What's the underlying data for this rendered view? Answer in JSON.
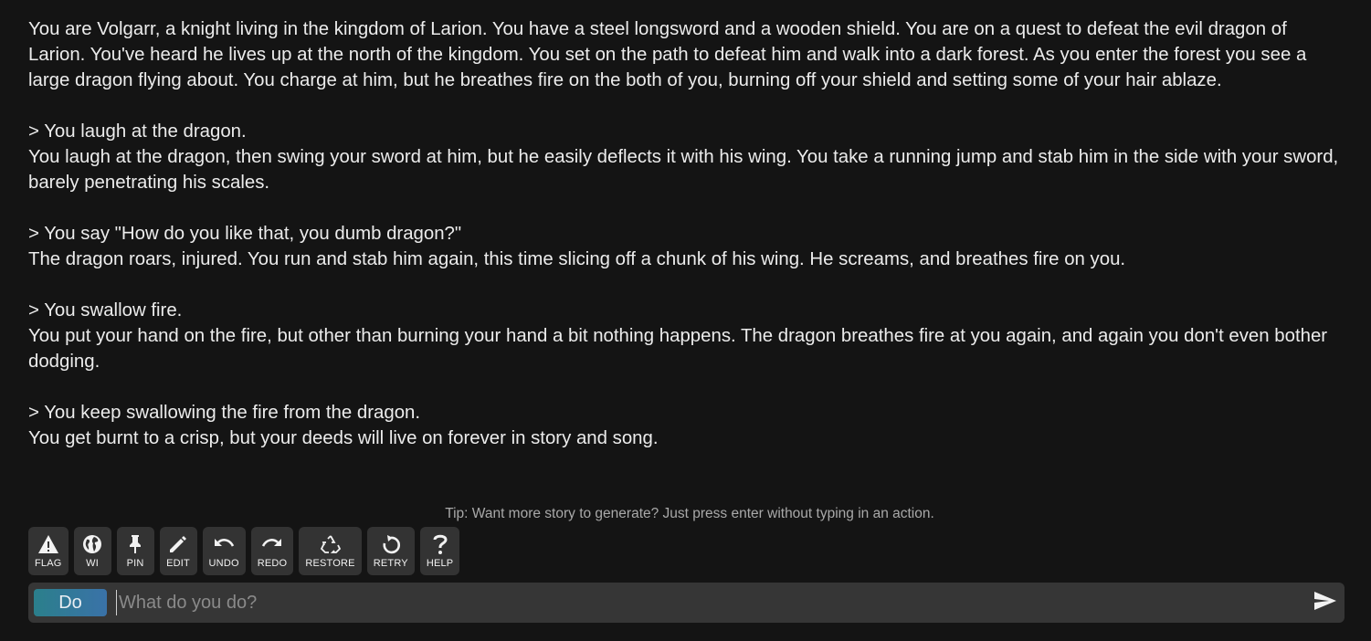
{
  "story": {
    "intro": "You are Volgarr, a knight living in the kingdom of Larion. You have a steel longsword and a wooden shield. You are on a quest to defeat the evil dragon of Larion. You've heard he lives up at the north of the kingdom. You set on the path to defeat him and walk into a dark forest. As you enter the forest you see a large dragon flying about. You charge at him, but he breathes fire on the both of you, burning off your shield and setting some of your hair ablaze.",
    "turns": [
      {
        "action": "> You laugh at the dragon.",
        "result": "You laugh at the dragon, then swing your sword at him, but he easily deflects it with his wing. You take a running jump and stab him in the side with your sword, barely penetrating his scales."
      },
      {
        "action": "> You say \"How do you like that, you dumb dragon?\"",
        "result": "The dragon roars, injured. You run and stab him again, this time slicing off a chunk of his wing. He screams, and breathes fire on you."
      },
      {
        "action": "> You swallow fire.",
        "result": "You put your hand on the fire, but other than burning your hand a bit nothing happens. The dragon breathes fire at you again, and again you don't even bother dodging."
      },
      {
        "action": "> You keep swallowing the fire from the dragon.",
        "result": "You get burnt to a crisp, but your deeds will live on forever in story and song."
      }
    ]
  },
  "tip": "Tip: Want more story to generate? Just press enter without typing in an action.",
  "toolbar": {
    "flag": {
      "label": "FLAG",
      "icon": "warning-triangle-icon"
    },
    "wi": {
      "label": "WI",
      "icon": "globe-icon"
    },
    "pin": {
      "label": "PIN",
      "icon": "pin-icon"
    },
    "edit": {
      "label": "EDIT",
      "icon": "pencil-icon"
    },
    "undo": {
      "label": "UNDO",
      "icon": "undo-icon"
    },
    "redo": {
      "label": "REDO",
      "icon": "redo-icon"
    },
    "restore": {
      "label": "RESTORE",
      "icon": "recycle-icon"
    },
    "retry": {
      "label": "RETRY",
      "icon": "retry-icon"
    },
    "help": {
      "label": "HELP",
      "icon": "question-mark-icon"
    }
  },
  "input": {
    "mode_label": "Do",
    "placeholder": "What do you do?",
    "value": "",
    "send_icon": "send-icon"
  },
  "colors": {
    "background": "#141414",
    "text": "#ececec",
    "button_bg": "#333333",
    "input_bg": "#363636",
    "do_gradient_start": "#2b7f8b",
    "do_gradient_end": "#3a72a8"
  }
}
